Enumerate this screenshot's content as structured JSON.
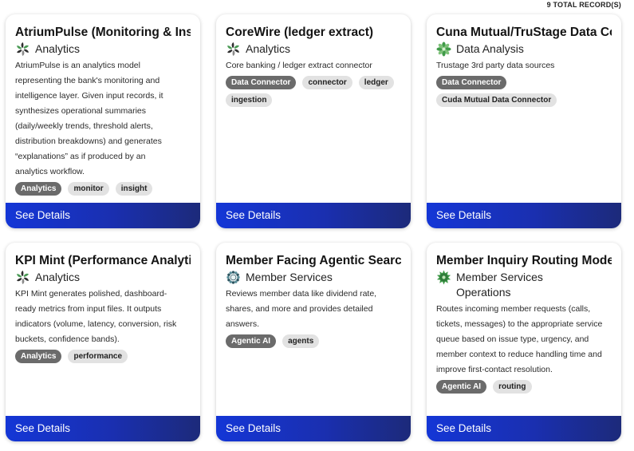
{
  "header": {
    "total_records": "9 TOTAL RECORD(S)"
  },
  "colors": {
    "button_start": "#1436d6",
    "button_end": "#1c2a7a",
    "tag_dark": "#6b6b6b",
    "tag_light": "#e2e2e2"
  },
  "cards": [
    {
      "title": "AtriumPulse (Monitoring & Insights)",
      "category": "Analytics",
      "icon": "analytics-pinwheel-icon",
      "description": "AtriumPulse is an analytics model representing the bank's monitoring and intelligence layer. Given input records, it synthesizes operational summaries (daily/weekly trends, threshold alerts, distribution breakdowns) and generates “explanations” as if produced by an analytics workflow.",
      "tags": [
        {
          "label": "Analytics",
          "style": "dark"
        },
        {
          "label": "monitor",
          "style": "light"
        },
        {
          "label": "insight",
          "style": "light"
        }
      ],
      "button": "See Details"
    },
    {
      "title": "CoreWire (ledger extract)",
      "category": "Analytics",
      "icon": "analytics-pinwheel-icon",
      "description": "Core banking / ledger extract connector",
      "tags": [
        {
          "label": "Data Connector",
          "style": "dark"
        },
        {
          "label": "connector",
          "style": "light"
        },
        {
          "label": "ledger",
          "style": "light"
        },
        {
          "label": "ingestion",
          "style": "light"
        }
      ],
      "button": "See Details"
    },
    {
      "title": "Cuna Mutual/TruStage Data Connector",
      "category": "Data Analysis",
      "icon": "data-analysis-leaf-icon",
      "description": "Trustage 3rd party data sources",
      "tags": [
        {
          "label": "Data Connector",
          "style": "dark"
        },
        {
          "label": "Cuda Mutual Data Connector",
          "style": "light"
        }
      ],
      "button": "See Details"
    },
    {
      "title": "KPI Mint (Performance Analytics)",
      "category": "Analytics",
      "icon": "analytics-pinwheel-icon",
      "description": "KPI Mint generates polished, dashboard-ready metrics from input files. It outputs indicators (volume, latency, conversion, risk buckets, confidence bands).",
      "tags": [
        {
          "label": "Analytics",
          "style": "dark"
        },
        {
          "label": "performance",
          "style": "light"
        }
      ],
      "button": "See Details"
    },
    {
      "title": "Member Facing Agentic Search",
      "category": "Member Services",
      "icon": "member-services-flower-icon",
      "description": "Reviews member data like dividend rate, shares, and more and provides detailed answers.",
      "tags": [
        {
          "label": "Agentic AI",
          "style": "dark"
        },
        {
          "label": "agents",
          "style": "light"
        }
      ],
      "button": "See Details"
    },
    {
      "title": "Member Inquiry Routing Model",
      "category": "Member Services Operations",
      "icon": "member-services-operations-gear-icon",
      "description": "Routes incoming member requests (calls, tickets, messages) to the appropriate service queue based on issue type, urgency, and member context to reduce handling time and improve first-contact resolution.",
      "tags": [
        {
          "label": "Agentic AI",
          "style": "dark"
        },
        {
          "label": "routing",
          "style": "light"
        }
      ],
      "button": "See Details"
    }
  ]
}
